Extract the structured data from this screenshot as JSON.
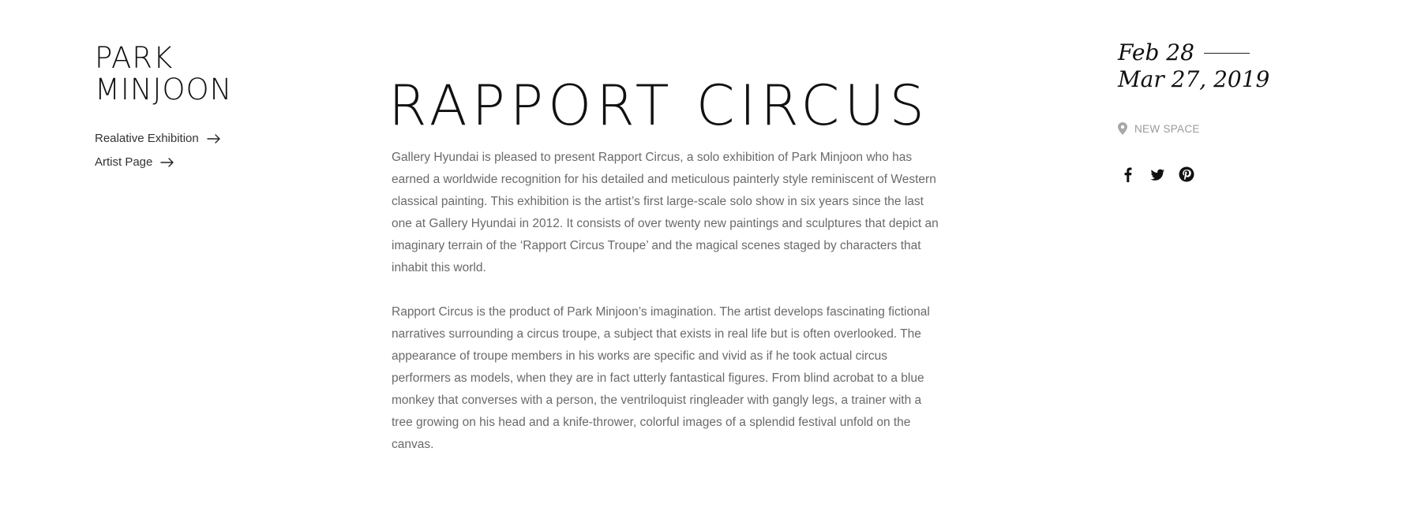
{
  "artist": {
    "name_line1": "PARK",
    "name_line2": "MINJOON"
  },
  "side_links": [
    {
      "label": "Realative Exhibition",
      "icon": "arrow-right-icon"
    },
    {
      "label": "Artist Page",
      "icon": "arrow-right-icon"
    }
  ],
  "exhibition": {
    "title": "RAPPORT CIRCUS",
    "paragraphs": [
      "Gallery Hyundai is pleased to present Rapport Circus, a solo exhibition of Park Minjoon who has earned a worldwide recognition for his detailed and meticulous painterly style reminiscent of Western classical painting. This exhibition is the artist’s first large-scale solo show in six years since the last one at Gallery Hyundai in 2012. It consists of over twenty new paintings and sculptures that depict an imaginary terrain of the ‘Rapport Circus Troupe’ and the magical scenes staged by characters that inhabit this world.",
      "Rapport Circus is the product of Park Minjoon’s imagination. The artist develops fascinating fictional narratives surrounding a circus troupe, a subject that exists in real life but is often overlooked. The appearance of troupe members in his works are specific and vivid as if he took actual circus performers as models, when they are in fact utterly fantastical figures. From blind acrobat to a blue monkey that converses with a person, the ventriloquist ringleader with gangly legs, a trainer with a tree growing on his head and a knife-thrower, colorful images of a splendid festival unfold on the canvas."
    ]
  },
  "dates": {
    "start": "Feb 28",
    "end": "Mar 27, 2019"
  },
  "location": {
    "icon": "location-pin-icon",
    "label": "NEW SPACE"
  },
  "social": [
    {
      "name": "facebook",
      "icon": "facebook-icon"
    },
    {
      "name": "twitter",
      "icon": "twitter-icon"
    },
    {
      "name": "pinterest",
      "icon": "pinterest-icon"
    }
  ],
  "colors": {
    "text_primary": "#111111",
    "text_body": "#6a6a6a",
    "text_muted": "#9a9a9a",
    "background": "#ffffff"
  }
}
